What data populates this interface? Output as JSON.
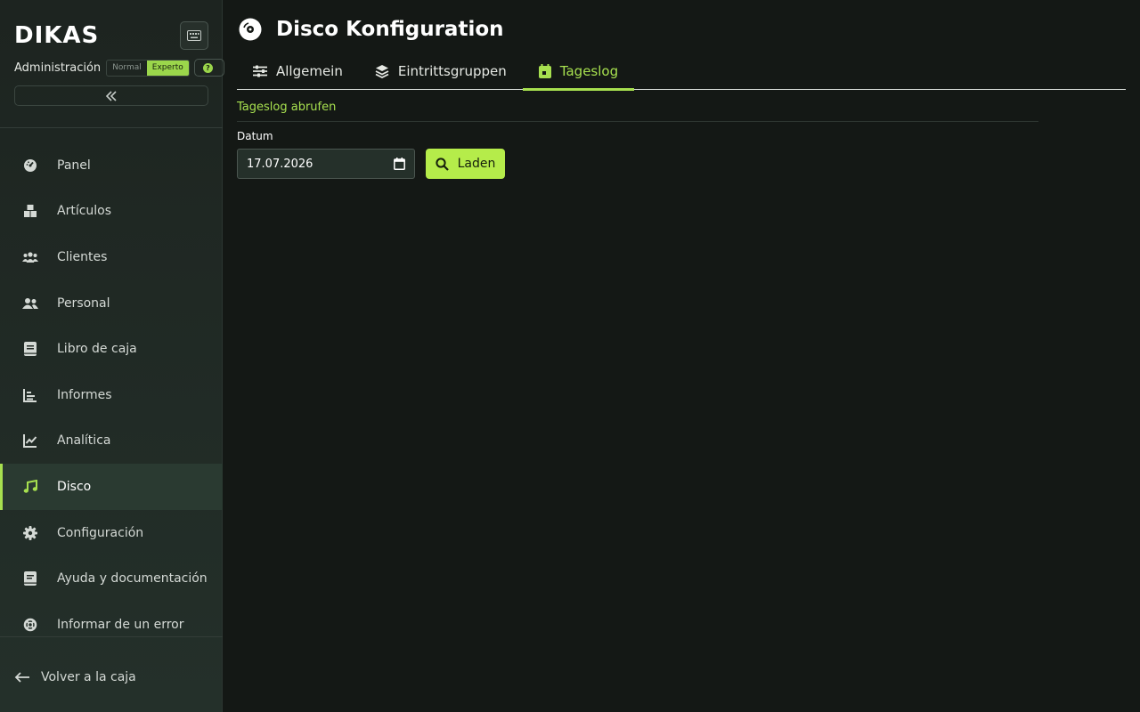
{
  "app": {
    "logo": "DIKAS",
    "role_label": "Administración",
    "modes": [
      "Normal",
      "Experto"
    ],
    "active_mode": "Experto",
    "help_symbol": "?"
  },
  "sidebar": {
    "items": [
      {
        "label": "Panel",
        "icon": "dashboard-icon"
      },
      {
        "label": "Artículos",
        "icon": "boxes-icon"
      },
      {
        "label": "Clientes",
        "icon": "customers-icon"
      },
      {
        "label": "Personal",
        "icon": "staff-icon"
      },
      {
        "label": "Libro de caja",
        "icon": "cashbook-icon"
      },
      {
        "label": "Informes",
        "icon": "reports-icon"
      },
      {
        "label": "Analítica",
        "icon": "analytics-icon"
      },
      {
        "label": "Disco",
        "icon": "music-icon",
        "active": true
      },
      {
        "label": "Configuración",
        "icon": "gear-icon"
      },
      {
        "label": "Ayuda y documentación",
        "icon": "book-icon"
      },
      {
        "label": "Informar de un error",
        "icon": "lifebuoy-icon"
      }
    ],
    "back_label": "Volver a la caja"
  },
  "page": {
    "title": "Disco Konfiguration",
    "tabs": [
      {
        "label": "Allgemein",
        "icon": "sliders-icon"
      },
      {
        "label": "Eintrittsgruppen",
        "icon": "layers-icon"
      },
      {
        "label": "Tageslog",
        "icon": "calendar-icon",
        "active": true
      }
    ],
    "section_title": "Tageslog abrufen",
    "date_label": "Datum",
    "date_value": "17.07.2026",
    "load_button": "Laden"
  },
  "colors": {
    "accent": "#a7e04f",
    "button": "#b5ec4a",
    "background": "#141815",
    "sidebar": "#1d2420"
  }
}
